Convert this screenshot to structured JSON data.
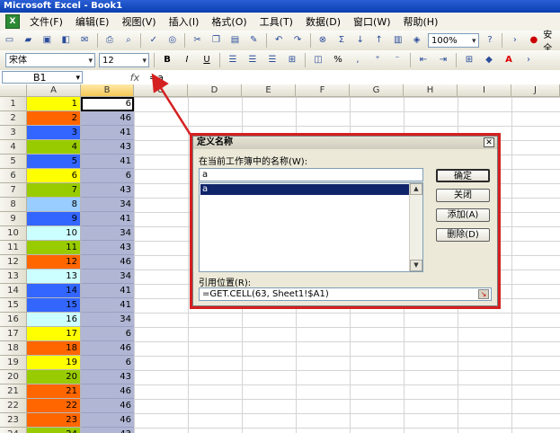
{
  "window": {
    "title": "Microsoft Excel - Book1"
  },
  "menu": [
    "文件(F)",
    "编辑(E)",
    "视图(V)",
    "插入(I)",
    "格式(O)",
    "工具(T)",
    "数据(D)",
    "窗口(W)",
    "帮助(H)"
  ],
  "toolbar": {
    "zoom": "100%",
    "font": "宋体",
    "font_size": "12",
    "bold": "B",
    "italic": "I",
    "underline": "U",
    "percent": "%",
    "right_label": "安全"
  },
  "formula_bar": {
    "name_box": "B1",
    "fx": "fx",
    "content": "=a"
  },
  "columns": [
    "A",
    "B",
    "C",
    "D",
    "E",
    "F",
    "G",
    "H",
    "I",
    "J"
  ],
  "rows": [
    {
      "row": "1",
      "a": "1",
      "b": "6",
      "color": "#ffff00"
    },
    {
      "row": "2",
      "a": "2",
      "b": "46",
      "color": "#ff6600"
    },
    {
      "row": "3",
      "a": "3",
      "b": "41",
      "color": "#3366ff"
    },
    {
      "row": "4",
      "a": "4",
      "b": "43",
      "color": "#99cc00"
    },
    {
      "row": "5",
      "a": "5",
      "b": "41",
      "color": "#3366ff"
    },
    {
      "row": "6",
      "a": "6",
      "b": "6",
      "color": "#ffff00"
    },
    {
      "row": "7",
      "a": "7",
      "b": "43",
      "color": "#99cc00"
    },
    {
      "row": "8",
      "a": "8",
      "b": "34",
      "color": "#99ccff"
    },
    {
      "row": "9",
      "a": "9",
      "b": "41",
      "color": "#3366ff"
    },
    {
      "row": "10",
      "a": "10",
      "b": "34",
      "color": "#ccffff"
    },
    {
      "row": "11",
      "a": "11",
      "b": "43",
      "color": "#99cc00"
    },
    {
      "row": "12",
      "a": "12",
      "b": "46",
      "color": "#ff6600"
    },
    {
      "row": "13",
      "a": "13",
      "b": "34",
      "color": "#ccffff"
    },
    {
      "row": "14",
      "a": "14",
      "b": "41",
      "color": "#3366ff"
    },
    {
      "row": "15",
      "a": "15",
      "b": "41",
      "color": "#3366ff"
    },
    {
      "row": "16",
      "a": "16",
      "b": "34",
      "color": "#ccffff"
    },
    {
      "row": "17",
      "a": "17",
      "b": "6",
      "color": "#ffff00"
    },
    {
      "row": "18",
      "a": "18",
      "b": "46",
      "color": "#ff6600"
    },
    {
      "row": "19",
      "a": "19",
      "b": "6",
      "color": "#ffff00"
    },
    {
      "row": "20",
      "a": "20",
      "b": "43",
      "color": "#99cc00"
    },
    {
      "row": "21",
      "a": "21",
      "b": "46",
      "color": "#ff6600"
    },
    {
      "row": "22",
      "a": "22",
      "b": "46",
      "color": "#ff6600"
    },
    {
      "row": "23",
      "a": "23",
      "b": "46",
      "color": "#ff6600"
    },
    {
      "row": "24",
      "a": "24",
      "b": "43",
      "color": "#99cc00"
    }
  ],
  "dialog": {
    "title": "定义名称",
    "names_label": "在当前工作簿中的名称(W):",
    "name_value": "a",
    "list_items": [
      "a"
    ],
    "ok": "确定",
    "close": "关闭",
    "add": "添加(A)",
    "delete": "删除(D)",
    "refers_label": "引用位置(R):",
    "refers_value": "=GET.CELL(63, Sheet1!$A1)"
  },
  "colors": {
    "highlight_red": "#d42020",
    "selection_column": "#b0b6d4"
  }
}
